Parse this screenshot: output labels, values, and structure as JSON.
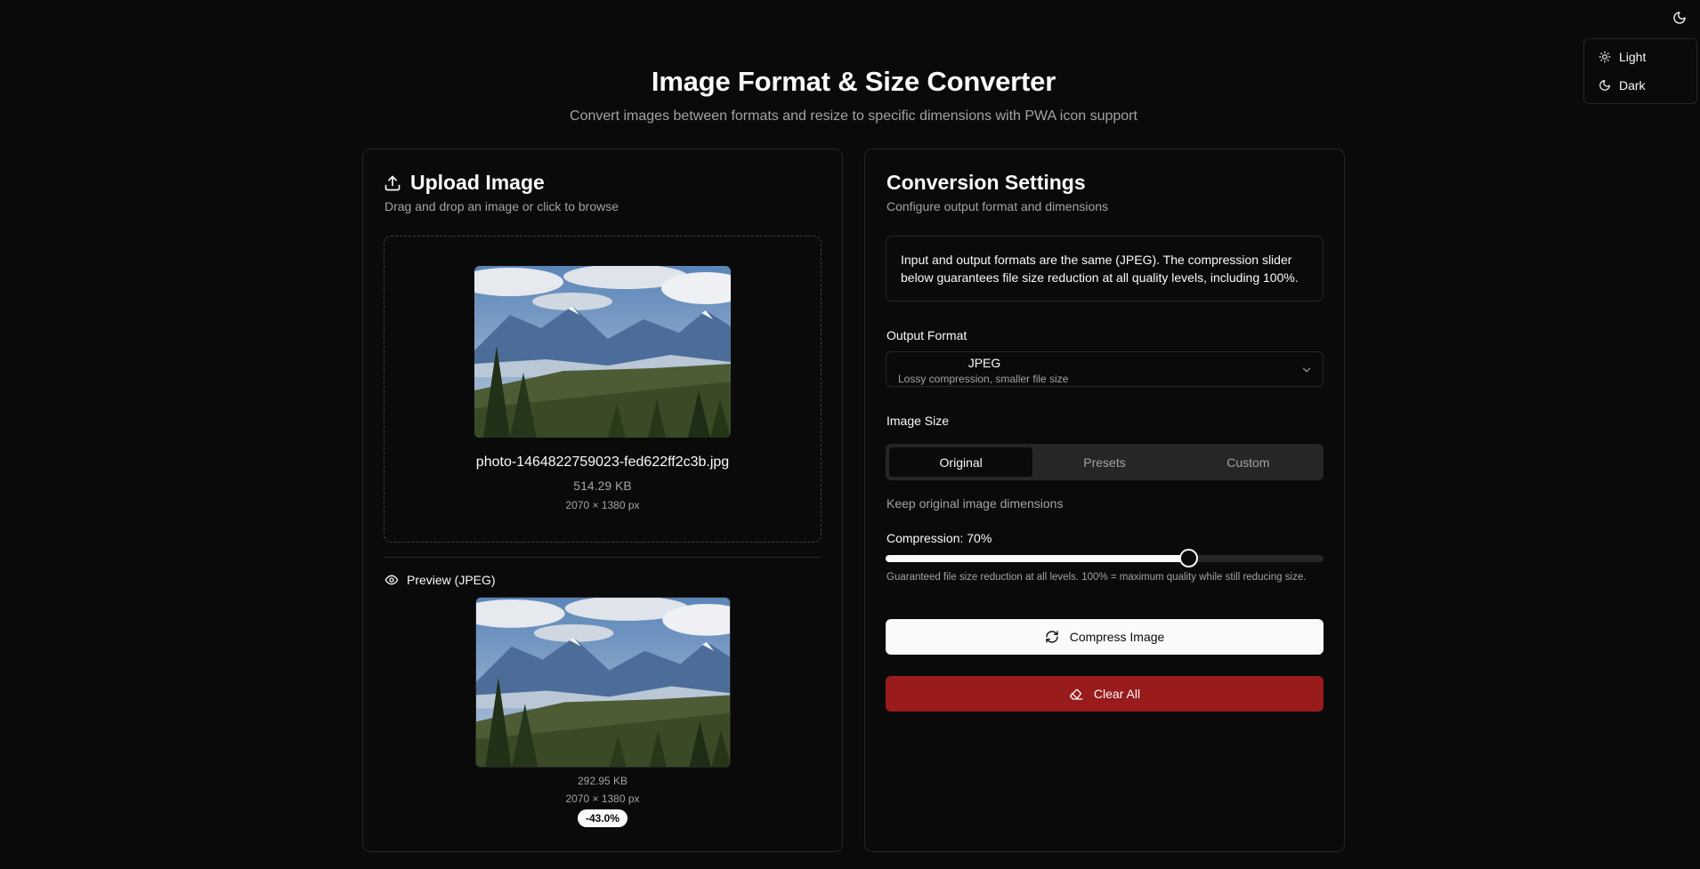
{
  "theme_menu": {
    "toggle_icon": "moon-icon",
    "items": [
      {
        "label": "Light",
        "icon": "sun-icon"
      },
      {
        "label": "Dark",
        "icon": "moon-icon"
      }
    ]
  },
  "header": {
    "title": "Image Format & Size Converter",
    "subtitle": "Convert images between formats and resize to specific dimensions with PWA icon support"
  },
  "upload": {
    "title": "Upload Image",
    "title_icon": "upload-icon",
    "description": "Drag and drop an image or click to browse",
    "file_name": "photo-1464822759023-fed622ff2c3b.jpg",
    "file_size": "514.29 KB",
    "dimensions": "2070 × 1380 px"
  },
  "preview": {
    "label": "Preview (JPEG)",
    "icon": "eye-icon",
    "file_size": "292.95 KB",
    "dimensions": "2070 × 1380 px",
    "reduction_badge": "-43.0%"
  },
  "settings": {
    "title": "Conversion Settings",
    "description": "Configure output format and dimensions",
    "notice": "Input and output formats are the same (JPEG). The compression slider below guarantees file size reduction at all quality levels, including 100%.",
    "output_format": {
      "label": "Output Format",
      "selected": "JPEG",
      "selected_desc": "Lossy compression, smaller file size"
    },
    "image_size": {
      "label": "Image Size",
      "tabs": [
        "Original",
        "Presets",
        "Custom"
      ],
      "active_tab": "Original",
      "hint": "Keep original image dimensions"
    },
    "compression": {
      "label": "Compression: 70%",
      "value": 70,
      "hint": "Guaranteed file size reduction at all levels. 100% = maximum quality while still reducing size."
    },
    "compress_button": "Compress Image",
    "clear_button": "Clear All"
  },
  "colors": {
    "background": "#0a0a0a",
    "border": "#262626",
    "muted_text": "#a3a3a3",
    "danger": "#991b1b"
  }
}
